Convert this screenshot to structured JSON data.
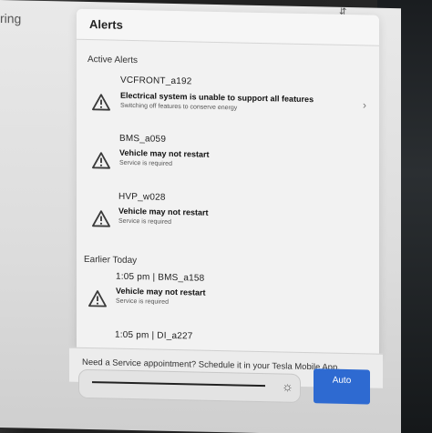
{
  "background": {
    "partial_title": "ring"
  },
  "modal": {
    "title": "Alerts"
  },
  "active_section": {
    "label": "Active Alerts",
    "items": [
      {
        "code": "VCFRONT_a192",
        "title": "Electrical system is unable to support all features",
        "subtitle": "Switching off features to conserve energy"
      },
      {
        "code": "BMS_a059",
        "title": "Vehicle may not restart",
        "subtitle": "Service is required"
      },
      {
        "code": "HVP_w028",
        "title": "Vehicle may not restart",
        "subtitle": "Service is required"
      }
    ]
  },
  "earlier_section": {
    "label": "Earlier Today",
    "items": [
      {
        "code": "1:05 pm | BMS_a158",
        "title": "Vehicle may not restart",
        "subtitle": "Service is required"
      },
      {
        "code": "1:05 pm | DI_a227",
        "title": "",
        "subtitle": ""
      }
    ]
  },
  "footer": {
    "text": "Need a Service appointment? Schedule it in your Tesla Mobile App."
  },
  "controls": {
    "auto_label": "Auto"
  },
  "colors": {
    "accent": "#2e6ad1",
    "warning_outline": "#3a3a3a"
  }
}
